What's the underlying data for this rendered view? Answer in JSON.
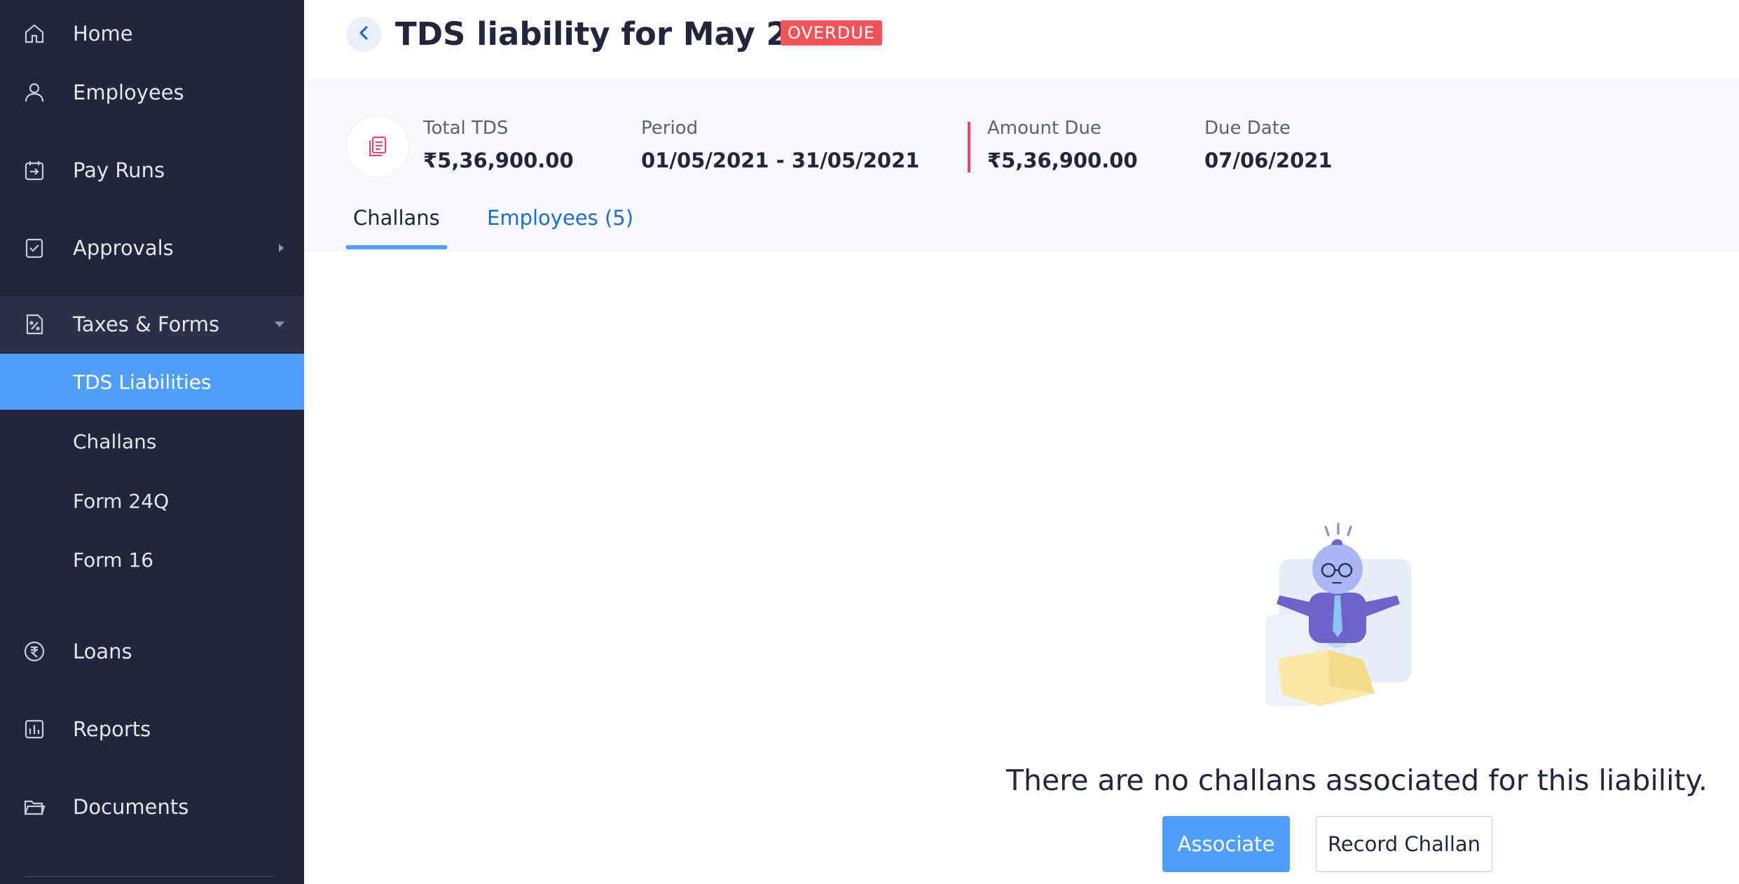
{
  "sidebar": {
    "items": [
      {
        "label": "Home",
        "icon": "home-icon"
      },
      {
        "label": "Employees",
        "icon": "user-icon"
      },
      {
        "label": "Pay Runs",
        "icon": "pay-runs-icon"
      },
      {
        "label": "Approvals",
        "icon": "approval-check-icon"
      },
      {
        "label": "Taxes & Forms",
        "icon": "percent-document-icon"
      },
      {
        "label": "Loans",
        "icon": "rupee-circle-icon"
      },
      {
        "label": "Reports",
        "icon": "bar-chart-icon"
      },
      {
        "label": "Documents",
        "icon": "folder-icon"
      }
    ],
    "sub_items": [
      {
        "label": "TDS Liabilities"
      },
      {
        "label": "Challans"
      },
      {
        "label": "Form 24Q"
      },
      {
        "label": "Form 16"
      }
    ]
  },
  "header": {
    "title": "TDS liability for May 2021",
    "status_badge": "OVERDUE"
  },
  "summary": {
    "total_tds_label": "Total TDS",
    "total_tds_value": "₹5,36,900.00",
    "period_label": "Period",
    "period_value": "01/05/2021 - 31/05/2021",
    "amount_due_label": "Amount Due",
    "amount_due_value": "₹5,36,900.00",
    "due_date_label": "Due Date",
    "due_date_value": "07/06/2021"
  },
  "tabs": [
    {
      "label": "Challans"
    },
    {
      "label": "Employees (5)"
    }
  ],
  "empty_state": {
    "message": "There are no challans associated for this liability.",
    "associate_label": "Associate",
    "record_label": "Record Challan"
  },
  "colors": {
    "sidebar_bg": "#21263c",
    "accent": "#4f9ef8",
    "overdue": "#f2545b",
    "link": "#1f6dc8",
    "due_marker": "#f0406c"
  }
}
